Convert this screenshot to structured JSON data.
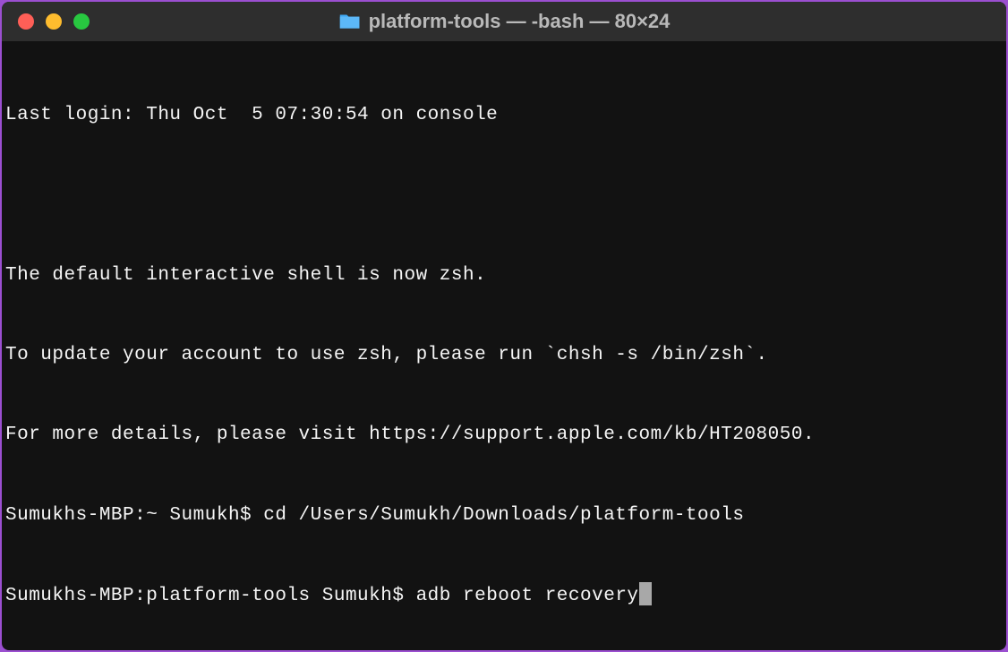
{
  "titlebar": {
    "title": "platform-tools — -bash — 80×24",
    "folder_icon": "folder-icon"
  },
  "terminal": {
    "lines": {
      "l0": "Last login: Thu Oct  5 07:30:54 on console",
      "l1": "",
      "l2": "The default interactive shell is now zsh.",
      "l3": "To update your account to use zsh, please run `chsh -s /bin/zsh`.",
      "l4": "For more details, please visit https://support.apple.com/kb/HT208050.",
      "prompt1": "Sumukhs-MBP:~ Sumukh$ ",
      "cmd1": "cd /Users/Sumukh/Downloads/platform-tools",
      "prompt2": "Sumukhs-MBP:platform-tools Sumukh$ ",
      "cmd2": "adb reboot recovery"
    }
  }
}
